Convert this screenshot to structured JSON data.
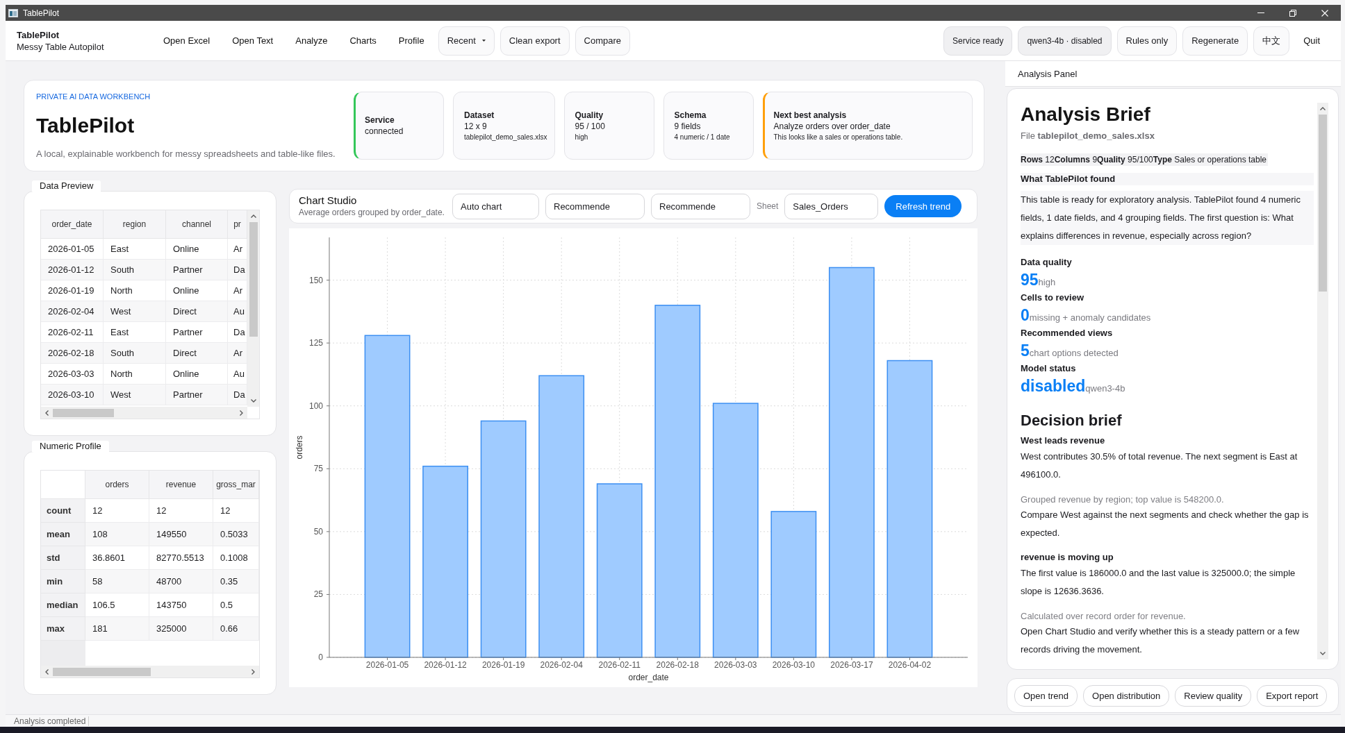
{
  "window": {
    "title": "TablePilot"
  },
  "toolbar": {
    "app_name": "TablePilot",
    "app_subtitle": "Messy Table Autopilot",
    "left_items": [
      {
        "label": "Open Excel",
        "kind": "menu"
      },
      {
        "label": "Open Text",
        "kind": "menu"
      },
      {
        "label": "Analyze",
        "kind": "menu"
      },
      {
        "label": "Charts",
        "kind": "menu"
      },
      {
        "label": "Profile",
        "kind": "menu"
      },
      {
        "label": "Recent",
        "kind": "dropdown"
      },
      {
        "label": "Clean export",
        "kind": "button"
      },
      {
        "label": "Compare",
        "kind": "button"
      }
    ],
    "right_items": [
      {
        "label": "Service ready",
        "kind": "status"
      },
      {
        "label": "qwen3-4b · disabled",
        "kind": "status"
      },
      {
        "label": "Rules only",
        "kind": "button"
      },
      {
        "label": "Regenerate",
        "kind": "button"
      },
      {
        "label": "中文",
        "kind": "button"
      },
      {
        "label": "Quit",
        "kind": "menu"
      }
    ]
  },
  "hero": {
    "eyebrow": "PRIVATE AI DATA WORKBENCH",
    "title": "TablePilot",
    "description": "A local, explainable workbench for messy spreadsheets and table-like files.",
    "stats": [
      {
        "title": "Service",
        "value": "connected",
        "color": "#34c759"
      },
      {
        "title": "Dataset",
        "value": "12 x 9",
        "note": "tablepilot_demo_sales.xlsx"
      },
      {
        "title": "Quality",
        "value": "95 / 100",
        "note": "high"
      },
      {
        "title": "Schema",
        "value": "9 fields",
        "note": "4 numeric / 1 date"
      },
      {
        "title": "Next best analysis",
        "value": "Analyze orders over order_date",
        "note": "This looks like a sales or operations table.",
        "color": "#ff9f0a"
      }
    ]
  },
  "data_preview": {
    "title": "Data Preview",
    "columns": [
      "order_date",
      "region",
      "channel",
      "pr"
    ],
    "rows": [
      [
        "2026-01-05",
        "East",
        "Online",
        "Ar"
      ],
      [
        "2026-01-12",
        "South",
        "Partner",
        "Da"
      ],
      [
        "2026-01-19",
        "North",
        "Online",
        "Ar"
      ],
      [
        "2026-02-04",
        "West",
        "Direct",
        "Au"
      ],
      [
        "2026-02-11",
        "East",
        "Partner",
        "Da"
      ],
      [
        "2026-02-18",
        "South",
        "Direct",
        "Ar"
      ],
      [
        "2026-03-03",
        "North",
        "Online",
        "Au"
      ],
      [
        "2026-03-10",
        "West",
        "Partner",
        "Da"
      ]
    ]
  },
  "numeric_profile": {
    "title": "Numeric Profile",
    "columns": [
      "orders",
      "revenue",
      "gross_mar"
    ],
    "rows": [
      {
        "label": "count",
        "values": [
          "12",
          "12",
          "12"
        ]
      },
      {
        "label": "mean",
        "values": [
          "108",
          "149550",
          "0.5033"
        ]
      },
      {
        "label": "std",
        "values": [
          "36.8601",
          "82770.5513",
          "0.1008"
        ]
      },
      {
        "label": "min",
        "values": [
          "58",
          "48700",
          "0.35"
        ]
      },
      {
        "label": "median",
        "values": [
          "106.5",
          "143750",
          "0.5"
        ]
      },
      {
        "label": "max",
        "values": [
          "181",
          "325000",
          "0.66"
        ]
      }
    ]
  },
  "chart_studio": {
    "title": "Chart Studio",
    "subtitle": "Average orders grouped by order_date.",
    "fields": [
      "Auto chart",
      "Recommende",
      "Recommende"
    ],
    "sheet_label": "Sheet",
    "sheet": "Sales_Orders",
    "refresh_button": "Refresh trend",
    "chart_data": {
      "type": "bar",
      "xlabel": "order_date",
      "ylabel": "orders",
      "categories": [
        "2026-01-05",
        "2026-01-12",
        "2026-01-19",
        "2026-02-04",
        "2026-02-11",
        "2026-02-18",
        "2026-03-03",
        "2026-03-10",
        "2026-03-17",
        "2026-04-02"
      ],
      "values": [
        128,
        76,
        94,
        112,
        69,
        140,
        101,
        58,
        155,
        118
      ],
      "ylim": [
        0,
        167
      ],
      "yticks": [
        0,
        25,
        50,
        75,
        100,
        125,
        150
      ],
      "grid": true
    }
  },
  "analysis_panel": {
    "title": "Analysis Panel",
    "heading": "Analysis Brief",
    "file_line": "File **tablepilot_demo_sales.xlsx**",
    "summary_line": "**Rows** 12**Columns** 9**Quality** 95/100**Type** Sales or operations table",
    "found_heading": "What TablePilot found",
    "found_text": "This table is ready for exploratory analysis. TablePilot found 4 numeric fields, 1 date fields, and 4 grouping fields. The first question is: What explains differences in revenue, especially across region?",
    "metrics": [
      {
        "label": "Data quality",
        "value": "95",
        "note": "high"
      },
      {
        "label": "Cells to review",
        "value": "0",
        "note": "missing + anomaly candidates"
      },
      {
        "label": "Recommended views",
        "value": "5",
        "note": "chart options detected"
      },
      {
        "label": "Model status",
        "value": "disabled",
        "note": "qwen3-4b"
      }
    ],
    "decision_heading": "Decision brief",
    "insights": [
      {
        "title": "West leads revenue",
        "text": "West contributes 30.5% of total revenue. The next segment is East at 496100.0.",
        "evidence": "Grouped revenue by region; top value is 548200.0.",
        "action": "Compare West against the next segments and check whether the gap is expected."
      },
      {
        "title": "revenue is moving up",
        "text": "The first value is 186000.0 and the last value is 325000.0; the simple slope is 12636.3636.",
        "evidence": "Calculated over record order for revenue.",
        "action": "Open Chart Studio and verify whether this is a steady pattern or a few records driving the movement."
      }
    ],
    "actions": [
      "Open trend",
      "Open distribution",
      "Review quality",
      "Export report"
    ]
  },
  "status_bar": {
    "text": "Analysis completed"
  }
}
